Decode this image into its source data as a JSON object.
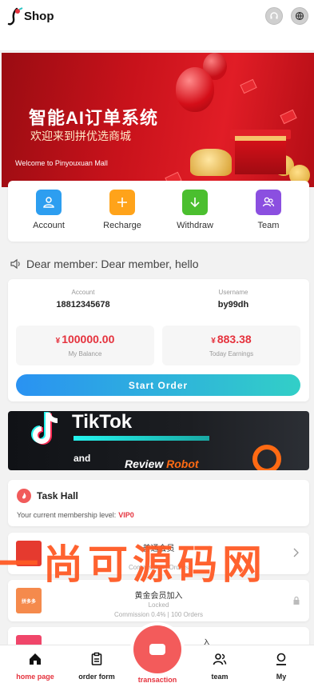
{
  "header": {
    "brand": "Shop",
    "icons": [
      "headset-icon",
      "globe-icon"
    ]
  },
  "banner": {
    "title": "智能AI订单系统",
    "subtitle": "欢迎来到拼优选商城",
    "welcome": "Welcome to Pinyouxuan Mall"
  },
  "actions": [
    {
      "label": "Account",
      "icon": "user-icon",
      "color": "#2d9ef0"
    },
    {
      "label": "Recharge",
      "icon": "plus-icon",
      "color": "#ffa31a"
    },
    {
      "label": "Withdraw",
      "icon": "download-icon",
      "color": "#4bbf2f"
    },
    {
      "label": "Team",
      "icon": "team-icon",
      "color": "#8b4fe0"
    }
  ],
  "notice": {
    "text": "Dear member: Dear member, hello"
  },
  "account": {
    "account_caption": "Account",
    "account_value": "18812345678",
    "username_caption": "Username",
    "username_value": "by99dh",
    "currency": "¥",
    "balance_value": "100000.00",
    "balance_caption": "My Balance",
    "earnings_value": "883.38",
    "earnings_caption": "Today Earnings",
    "start_button": "Start Order"
  },
  "promo": {
    "brand": "TikTok",
    "and": "and",
    "review": "Review",
    "robot": "Robot"
  },
  "task_hall": {
    "title": "Task Hall",
    "level_label": "Your current membership level:",
    "level_value": "VIP0"
  },
  "memberships": [
    {
      "logo": "",
      "name": "普通会员",
      "status": "",
      "commission": "Commission | Orders"
    },
    {
      "logo": "拼多多",
      "name": "黄金会员加入",
      "status": "Locked",
      "commission": "Commission 0.4% | 100 Orders"
    },
    {
      "logo": "",
      "name": "入",
      "status": "",
      "commission": ""
    }
  ],
  "watermark": "一尚可源码网",
  "nav": {
    "home": "home page",
    "order": "order form",
    "transaction": "transaction",
    "team": "team",
    "my": "My"
  },
  "colors": {
    "accent_red": "#e5323d",
    "button_gradient_start": "#2a92f2",
    "button_gradient_end": "#32cfc7"
  }
}
